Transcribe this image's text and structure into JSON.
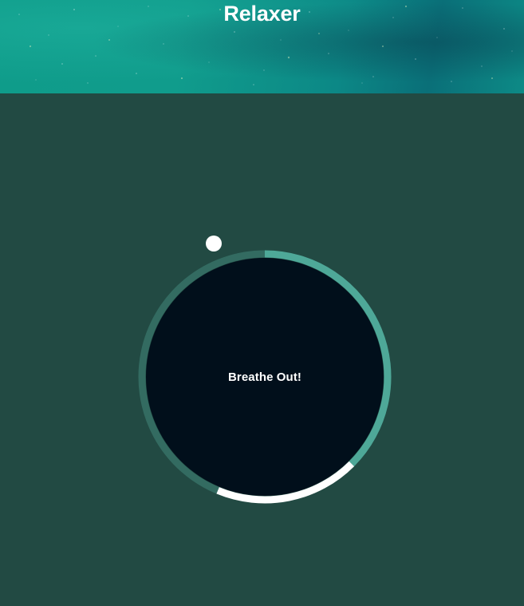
{
  "app": {
    "title": "Relaxer"
  },
  "breathing": {
    "status_text": "Breathe Out!",
    "phases": [
      {
        "name": "breathe-in",
        "fraction": 0.375,
        "color": "#4ea898"
      },
      {
        "name": "hold",
        "fraction": 0.1875,
        "color": "#ffffff"
      },
      {
        "name": "breathe-out",
        "fraction": 0.4375,
        "color": "#336b61"
      }
    ],
    "pointer_progress": 0.875
  },
  "colors": {
    "background": "#224a43",
    "header_teal": "#0f9c8a",
    "circle_fill": "#010f1b",
    "pointer": "#ffffff"
  }
}
